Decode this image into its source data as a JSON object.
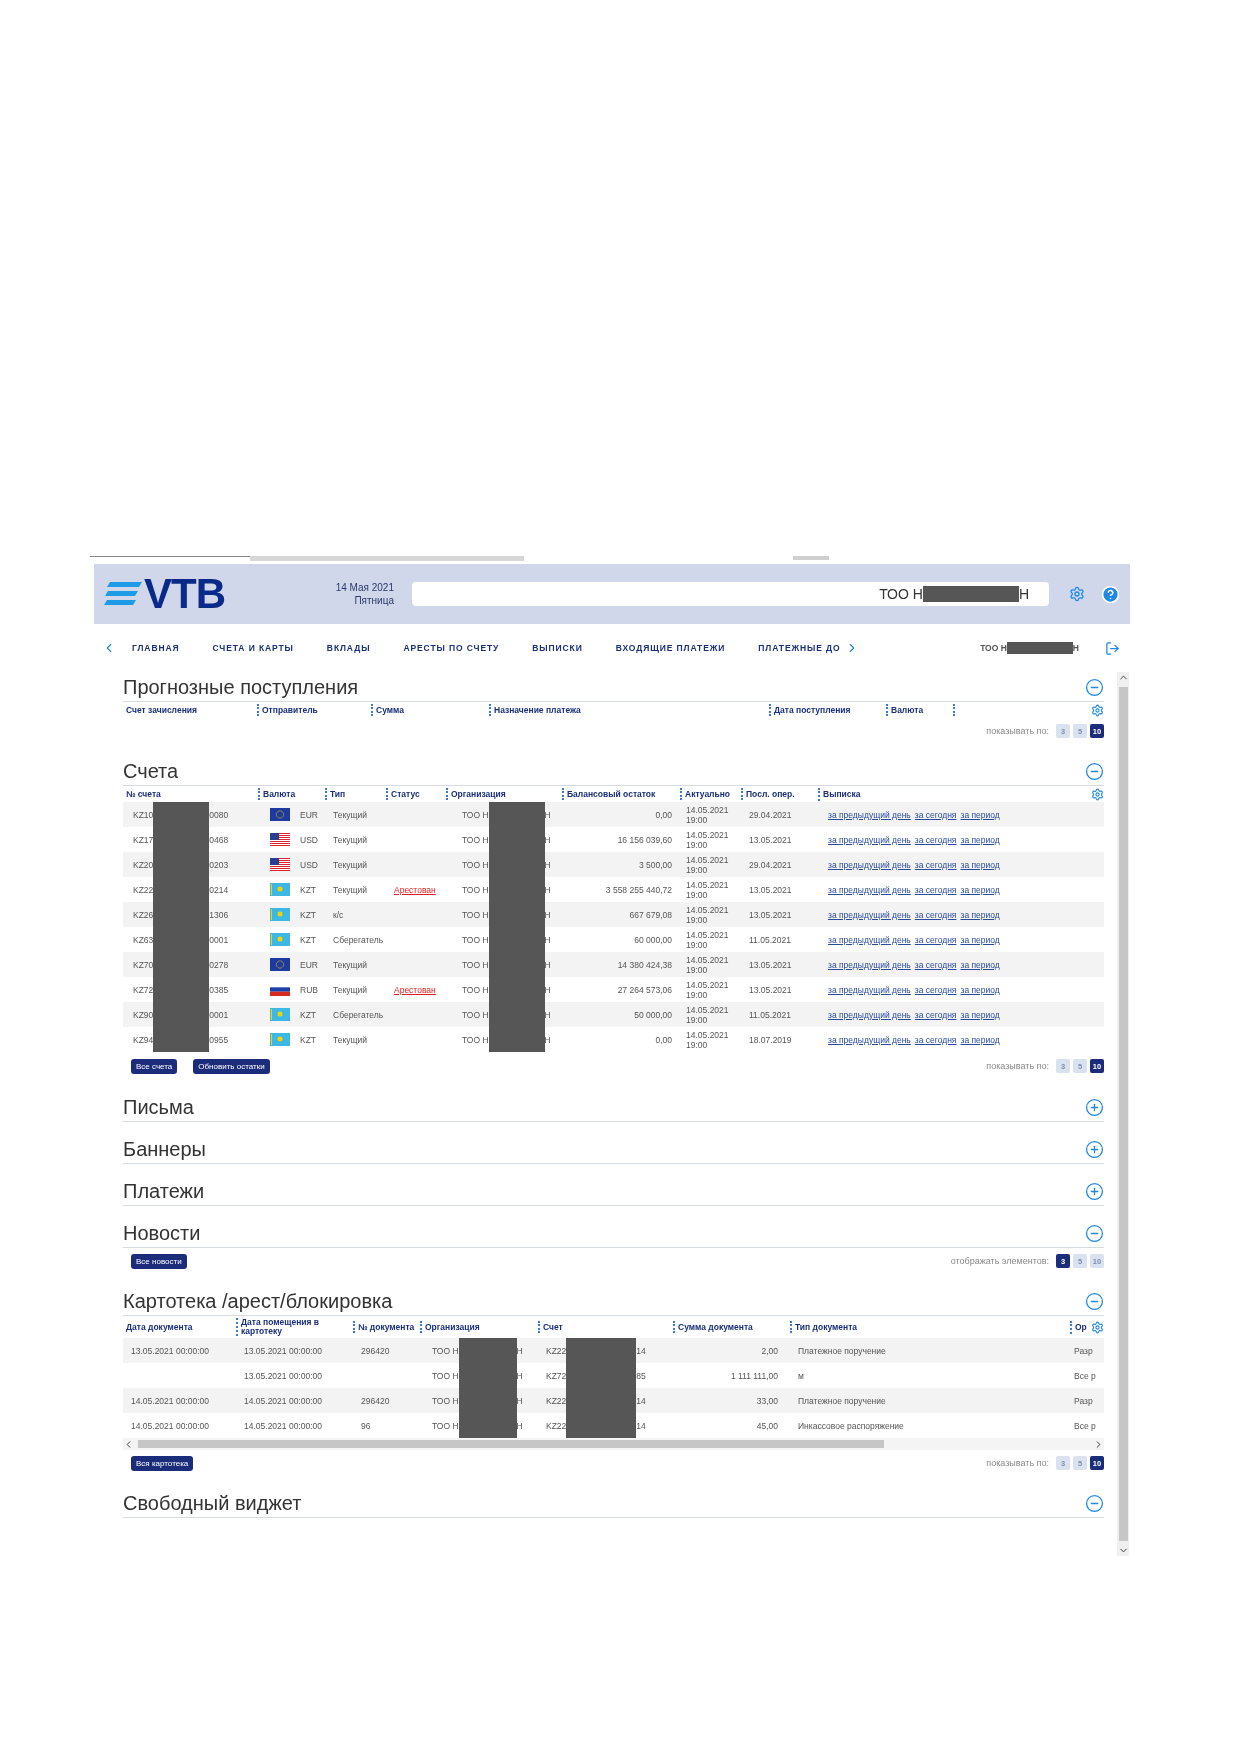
{
  "header": {
    "logo": "VTB",
    "date": "14 Мая 2021",
    "weekday": "Пятница",
    "company": {
      "prefix": "ТОО Н",
      "suffix": "Н"
    }
  },
  "nav": {
    "items": [
      "ГЛАВНАЯ",
      "СЧЕТА И КАРТЫ",
      "ВКЛАДЫ",
      "АРЕСТЫ ПО СЧЕТУ",
      "ВЫПИСКИ",
      "ВХОДЯЩИЕ ПЛАТЕЖИ",
      "ПЛАТЕЖНЫЕ ДО"
    ],
    "company": {
      "prefix": "ТОО Н",
      "suffix": "Н"
    }
  },
  "sections": [
    {
      "kind": "forecast",
      "title": "Прогнозные поступления",
      "expanded": true,
      "columns": [
        "Счет зачисления",
        "Отправитель",
        "Сумма",
        "Назначение платежа",
        "Дата поступления",
        "Валюта"
      ],
      "pager": {
        "label": "показывать по:",
        "options": [
          {
            "label": "3",
            "selected": false
          },
          {
            "label": "5",
            "selected": false
          },
          {
            "label": "10",
            "selected": true
          }
        ]
      }
    },
    {
      "kind": "accounts",
      "title": "Счета",
      "expanded": true,
      "columns": [
        "№ счета",
        "Валюта",
        "Тип",
        "Статус",
        "Организация",
        "Балансовый остаток",
        "Актуально",
        "Посл. опер.",
        "Выписка"
      ],
      "rows": [
        {
          "account": {
            "prefix": "KZ10",
            "suffix": "0080"
          },
          "flag": {
            "kind": "eu"
          },
          "currency": "EUR",
          "type": "Текущий",
          "organization": {
            "prefix": "ТОО Н",
            "suffix": "Н"
          },
          "balance": "0,00",
          "actual": [
            "14.05.2021",
            "19:00"
          ],
          "last_op": "29.04.2021",
          "statement": [
            "за предыдущий день",
            "за сегодня",
            "за период"
          ]
        },
        {
          "account": {
            "prefix": "KZ17",
            "suffix": "0468"
          },
          "flag": {
            "kind": "us"
          },
          "currency": "USD",
          "type": "Текущий",
          "organization": {
            "prefix": "ТОО Н",
            "suffix": "Н"
          },
          "balance": "16 156 039,60",
          "actual": [
            "14.05.2021",
            "19:00"
          ],
          "last_op": "13.05.2021",
          "statement": [
            "за предыдущий день",
            "за сегодня",
            "за период"
          ]
        },
        {
          "account": {
            "prefix": "KZ20",
            "suffix": "0203"
          },
          "flag": {
            "kind": "us"
          },
          "currency": "USD",
          "type": "Текущий",
          "organization": {
            "prefix": "ТОО Н",
            "suffix": "Н"
          },
          "balance": "3 500,00",
          "actual": [
            "14.05.2021",
            "19:00"
          ],
          "last_op": "29.04.2021",
          "statement": [
            "за предыдущий день",
            "за сегодня",
            "за период"
          ]
        },
        {
          "account": {
            "prefix": "KZ22",
            "suffix": "0214"
          },
          "flag": {
            "kind": "kz"
          },
          "currency": "KZT",
          "type": "Текущий",
          "status": "Арестован",
          "organization": {
            "prefix": "ТОО Н",
            "suffix": "Н"
          },
          "balance": "3 558 255 440,72",
          "actual": [
            "14.05.2021",
            "19:00"
          ],
          "last_op": "13.05.2021",
          "statement": [
            "за предыдущий день",
            "за сегодня",
            "за период"
          ]
        },
        {
          "account": {
            "prefix": "KZ26",
            "suffix": "1306"
          },
          "flag": {
            "kind": "kz"
          },
          "currency": "KZT",
          "type": "к/с",
          "organization": {
            "prefix": "ТОО Н",
            "suffix": "Н"
          },
          "balance": "667 679,08",
          "actual": [
            "14.05.2021",
            "19:00"
          ],
          "last_op": "13.05.2021",
          "statement": [
            "за предыдущий день",
            "за сегодня",
            "за период"
          ]
        },
        {
          "account": {
            "prefix": "KZ63",
            "suffix": "0001"
          },
          "flag": {
            "kind": "kz"
          },
          "currency": "KZT",
          "type": "Сберегатель",
          "organization": {
            "prefix": "ТОО Н",
            "suffix": "Н"
          },
          "balance": "60 000,00",
          "actual": [
            "14.05.2021",
            "19:00"
          ],
          "last_op": "11.05.2021",
          "statement": [
            "за предыдущий день",
            "за сегодня",
            "за период"
          ]
        },
        {
          "account": {
            "prefix": "KZ70",
            "suffix": "0278"
          },
          "flag": {
            "kind": "eu"
          },
          "currency": "EUR",
          "type": "Текущий",
          "organization": {
            "prefix": "ТОО Н",
            "suffix": "Н"
          },
          "balance": "14 380 424,38",
          "actual": [
            "14.05.2021",
            "19:00"
          ],
          "last_op": "13.05.2021",
          "statement": [
            "за предыдущий день",
            "за сегодня",
            "за период"
          ]
        },
        {
          "account": {
            "prefix": "KZ72",
            "suffix": "0385"
          },
          "flag": {
            "kind": "ru"
          },
          "currency": "RUB",
          "type": "Текущий",
          "status": "Арестован",
          "organization": {
            "prefix": "ТОО Н",
            "suffix": "Н"
          },
          "balance": "27 264 573,06",
          "actual": [
            "14.05.2021",
            "19:00"
          ],
          "last_op": "13.05.2021",
          "statement": [
            "за предыдущий день",
            "за сегодня",
            "за период"
          ]
        },
        {
          "account": {
            "prefix": "KZ90",
            "suffix": "0001"
          },
          "flag": {
            "kind": "kz"
          },
          "currency": "KZT",
          "type": "Сберегатель",
          "organization": {
            "prefix": "ТОО Н",
            "suffix": "Н"
          },
          "balance": "50 000,00",
          "actual": [
            "14.05.2021",
            "19:00"
          ],
          "last_op": "11.05.2021",
          "statement": [
            "за предыдущий день",
            "за сегодня",
            "за период"
          ]
        },
        {
          "account": {
            "prefix": "KZ94",
            "suffix": "0955"
          },
          "flag": {
            "kind": "kz"
          },
          "currency": "KZT",
          "type": "Текущий",
          "organization": {
            "prefix": "ТОО Н",
            "suffix": "Н"
          },
          "balance": "0,00",
          "actual": [
            "14.05.2021",
            "19:00"
          ],
          "last_op": "18.07.2019",
          "statement": [
            "за предыдущий день",
            "за сегодня",
            "за период"
          ]
        }
      ],
      "buttons": [
        "Все счета",
        "Обновить остатки"
      ],
      "pager": {
        "label": "показывать по:",
        "options": [
          {
            "label": "3",
            "selected": false
          },
          {
            "label": "5",
            "selected": false
          },
          {
            "label": "10",
            "selected": true
          }
        ]
      }
    },
    {
      "kind": "plain",
      "title": "Письма",
      "expanded": false
    },
    {
      "kind": "plain",
      "title": "Баннеры",
      "expanded": false
    },
    {
      "kind": "plain",
      "title": "Платежи",
      "expanded": false
    },
    {
      "kind": "news",
      "title": "Новости",
      "expanded": true,
      "buttons": [
        "Все новости"
      ],
      "pager": {
        "label": "отображать элементов:",
        "options": [
          {
            "label": "3",
            "selected": true
          },
          {
            "label": "5",
            "selected": false
          },
          {
            "label": "10",
            "selected": false
          }
        ]
      }
    },
    {
      "kind": "registry",
      "title": "Картотека /арест/блокировка",
      "expanded": true,
      "columns": [
        "Дата документа",
        "Дата помещения в картотеку",
        "№ документа",
        "Организация",
        "Счет",
        "Сумма документа",
        "Тип документа",
        "Ор"
      ],
      "rows": [
        {
          "doc_date": "13.05.2021 00:00:00",
          "placed_date": "13.05.2021 00:00:00",
          "doc_no": "296420",
          "organization": {
            "prefix": "ТОО Н",
            "suffix": "Н"
          },
          "account": {
            "prefix": "KZ22",
            "suffix": "14"
          },
          "amount": "2,00",
          "doc_type": "Платежное поручение",
          "column_8": "Разр"
        },
        {
          "placed_date": "13.05.2021 00:00:00",
          "organization": {
            "prefix": "ТОО Н",
            "suffix": "Н"
          },
          "account": {
            "prefix": "KZ72",
            "suffix": "85"
          },
          "amount": "1 111 111,00",
          "doc_type": "м",
          "column_8": "Все р"
        },
        {
          "doc_date": "14.05.2021 00:00:00",
          "placed_date": "14.05.2021 00:00:00",
          "doc_no": "296420",
          "organization": {
            "prefix": "ТОО Н",
            "suffix": "Н"
          },
          "account": {
            "prefix": "KZ22",
            "suffix": "14"
          },
          "amount": "33,00",
          "doc_type": "Платежное поручение",
          "column_8": "Разр"
        },
        {
          "doc_date": "14.05.2021 00:00:00",
          "placed_date": "14.05.2021 00:00:00",
          "doc_no": "96",
          "organization": {
            "prefix": "ТОО Н",
            "suffix": "Н"
          },
          "account": {
            "prefix": "KZ22",
            "suffix": "14"
          },
          "amount": "45,00",
          "doc_type": "Инкассовое распоряжение",
          "column_8": "Все р"
        }
      ],
      "buttons": [
        "Вся картотека"
      ],
      "pager": {
        "label": "показывать по:",
        "options": [
          {
            "label": "3",
            "selected": false
          },
          {
            "label": "5",
            "selected": false
          },
          {
            "label": "10",
            "selected": true
          }
        ]
      }
    },
    {
      "kind": "plain",
      "title": "Свободный виджет",
      "expanded": true
    }
  ]
}
